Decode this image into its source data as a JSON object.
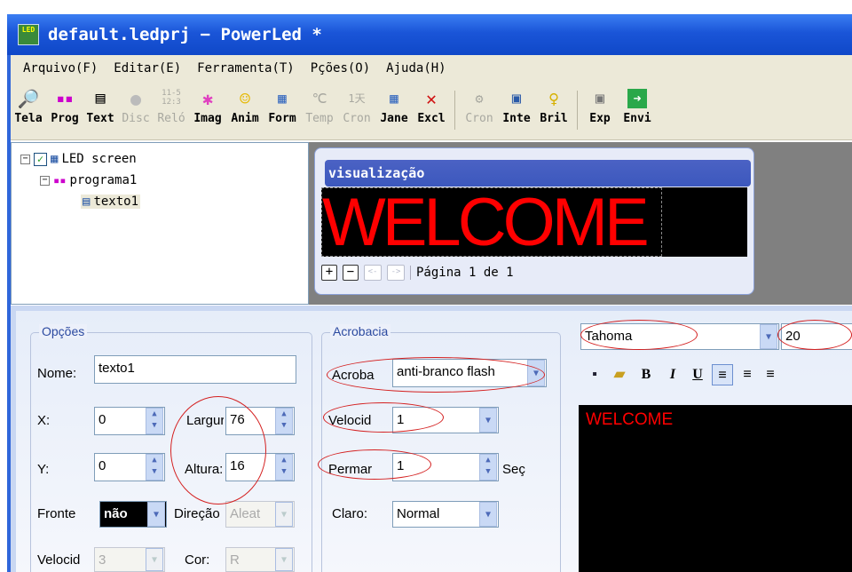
{
  "window": {
    "title": "default.ledprj − PowerLed *",
    "icon": "led-app-icon"
  },
  "menu": [
    "Arquivo(F)",
    "Editar(E)",
    "Ferramenta(T)",
    "Pções(O)",
    "Ajuda(H)"
  ],
  "toolbar": [
    {
      "label": "Tela",
      "icon": "magnifier-icon",
      "enabled": true
    },
    {
      "label": "Prog",
      "icon": "program-icon",
      "enabled": true
    },
    {
      "label": "Text",
      "icon": "text-icon",
      "enabled": true
    },
    {
      "label": "Disc",
      "icon": "disc-icon",
      "enabled": false
    },
    {
      "label": "Reló",
      "icon": "clock-icon",
      "enabled": false
    },
    {
      "label": "Imag",
      "icon": "image-icon",
      "enabled": true
    },
    {
      "label": "Anim",
      "icon": "smiley-icon",
      "enabled": true
    },
    {
      "label": "Form",
      "icon": "table-icon",
      "enabled": true
    },
    {
      "label": "Temp",
      "icon": "temperature-icon",
      "enabled": false
    },
    {
      "label": "Cron",
      "icon": "calendar-icon",
      "enabled": false
    },
    {
      "label": "Jane",
      "icon": "window-icon",
      "enabled": true
    },
    {
      "label": "Excl",
      "icon": "delete-icon",
      "enabled": true
    },
    {
      "label": "Cron",
      "icon": "stamp-icon",
      "enabled": false
    },
    {
      "label": "Inte",
      "icon": "monitor-icon",
      "enabled": true
    },
    {
      "label": "Bril",
      "icon": "bulb-icon",
      "enabled": true
    },
    {
      "label": "Exp",
      "icon": "export-icon",
      "enabled": true
    },
    {
      "label": "Envi",
      "icon": "send-icon",
      "enabled": true
    }
  ],
  "toolbar_glyphs": {
    "clock": "11-5 12:3",
    "temp": "℃",
    "cron": "1天"
  },
  "tree": {
    "root": "LED screen",
    "program": "programa1",
    "item": "texto1",
    "pm_minus": "−",
    "check": "✓"
  },
  "preview": {
    "title": "visualização",
    "led_text": "WELCOME",
    "page_label": "Página 1 de 1",
    "btn_plus": "+",
    "btn_minus": "−",
    "btn_prev": "<-",
    "btn_next": "->"
  },
  "options": {
    "group_label": "Opções",
    "name_label": "Nome:",
    "name_value": "texto1",
    "x_label": "X:",
    "x_value": "0",
    "y_label": "Y:",
    "y_value": "0",
    "width_label": "Largur:",
    "width_value": "76",
    "height_label": "Altura:",
    "height_value": "16",
    "front_label": "Fronte",
    "front_value": "não",
    "direction_label": "Direção",
    "direction_value": "Aleat",
    "speed_label": "Velocid",
    "speed_value": "3",
    "color_label": "Cor:",
    "color_value": "R"
  },
  "acro": {
    "group_label": "Acrobacia",
    "acro_label": "Acroba",
    "acro_value": "anti-branco flash",
    "speed_label": "Velocid",
    "speed_value": "1",
    "perm_label": "Permar",
    "perm_value": "1",
    "perm_unit": "Seç",
    "clear_label": "Claro:",
    "clear_value": "Normal"
  },
  "font": {
    "family": "Tahoma",
    "size": "20",
    "bold": "B",
    "italic": "I",
    "underline": "U",
    "align_left": "≡",
    "align_center": "≡",
    "align_right": "≡"
  },
  "editor": {
    "text": "WELCOME",
    "text_color": "#ff0000"
  },
  "colors": {
    "titlebar": "#1a55d8",
    "led": "#ff0000",
    "annotation": "#d42020"
  }
}
